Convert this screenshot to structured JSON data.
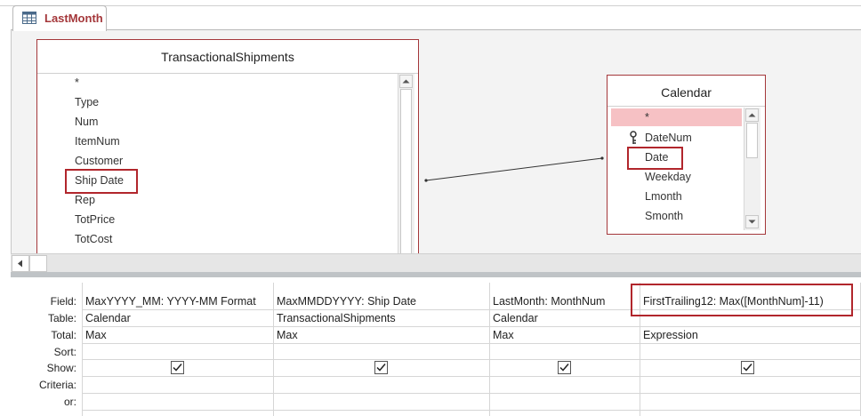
{
  "document_tab": {
    "title": "LastMonth",
    "icon": "query-design-icon"
  },
  "tables": {
    "transactional_shipments": {
      "title": "TransactionalShipments",
      "fields": [
        "*",
        "Type",
        "Num",
        "ItemNum",
        "Customer",
        "Ship Date",
        "Rep",
        "TotPrice",
        "TotCost"
      ]
    },
    "calendar": {
      "title": "Calendar",
      "fields": [
        "*",
        "DateNum",
        "Date",
        "Weekday",
        "Lmonth",
        "Smonth"
      ],
      "key_field": "DateNum"
    }
  },
  "grid": {
    "row_labels": [
      "Field:",
      "Table:",
      "Total:",
      "Sort:",
      "Show:",
      "Criteria:",
      "or:"
    ],
    "columns": [
      {
        "field": "MaxYYYY_MM: YYYY-MM Format",
        "table": "Calendar",
        "total": "Max",
        "sort": "",
        "show": true,
        "criteria": "",
        "or": ""
      },
      {
        "field": "MaxMMDDYYYY: Ship Date",
        "table": "TransactionalShipments",
        "total": "Max",
        "sort": "",
        "show": true,
        "criteria": "",
        "or": ""
      },
      {
        "field": "LastMonth: MonthNum",
        "table": "Calendar",
        "total": "Max",
        "sort": "",
        "show": true,
        "criteria": "",
        "or": ""
      },
      {
        "field": "FirstTrailing12: Max([MonthNum]-11)",
        "table": "",
        "total": "Expression",
        "sort": "",
        "show": true,
        "criteria": "",
        "or": ""
      }
    ]
  },
  "colors": {
    "accent": "#a4373a",
    "highlight_box": "#b1262c",
    "selected_row": "#f6c1c4"
  }
}
